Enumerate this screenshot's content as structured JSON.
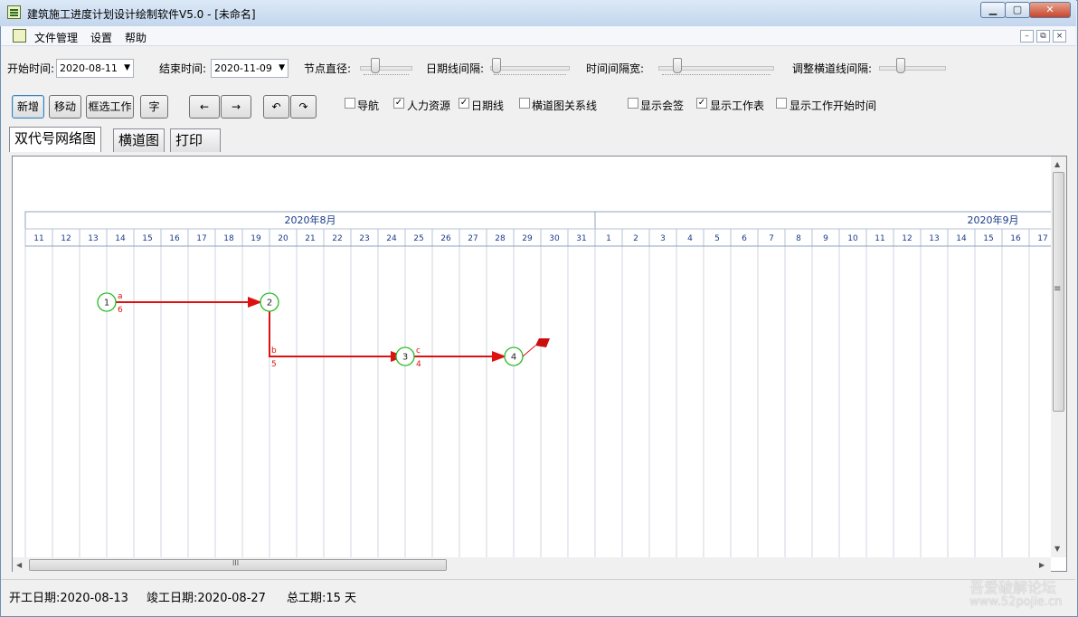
{
  "window": {
    "title": "建筑施工进度计划设计绘制软件V5.0 - [未命名]",
    "minimize_label": "▁",
    "maximize_label": "▢",
    "close_label": "✕"
  },
  "menu": {
    "items": [
      "文件管理",
      "设置",
      "帮助"
    ],
    "mdi_buttons": [
      "–",
      "⧉",
      "×"
    ]
  },
  "params": {
    "start_label": "开始时间:",
    "start_value": "2020-08-11",
    "end_label": "结束时间:",
    "end_value": "2020-11-09",
    "node_diameter_label": "节点直径:",
    "dateline_spacing_label": "日期线间隔:",
    "time_spacing_label": "时间间隔宽:",
    "lane_spacing_label": "调整横道线间隔:"
  },
  "toolbar": {
    "add": "新增",
    "move": "移动",
    "box_select": "框选工作",
    "text": "字",
    "left": "←",
    "right": "→",
    "undo": "↶",
    "redo": "↷"
  },
  "checkboxes": [
    {
      "label": "导航",
      "checked": false
    },
    {
      "label": "人力资源",
      "checked": true
    },
    {
      "label": "日期线",
      "checked": true
    },
    {
      "label": "横道图关系线",
      "checked": false
    },
    {
      "label": "显示会签",
      "checked": false
    },
    {
      "label": "显示工作表",
      "checked": true
    },
    {
      "label": "显示工作开始时间",
      "checked": false
    }
  ],
  "tabs": [
    "双代号网络图",
    "横道图",
    "打印"
  ],
  "chart_data": {
    "type": "network",
    "months": [
      {
        "label": "2020年8月",
        "days": [
          11,
          12,
          13,
          14,
          15,
          16,
          17,
          18,
          19,
          20,
          21,
          22,
          23,
          24,
          25,
          26,
          27,
          28,
          29,
          30,
          31
        ]
      },
      {
        "label": "2020年9月",
        "days": [
          1,
          2,
          3,
          4,
          5,
          6,
          7,
          8,
          9,
          10,
          11,
          12,
          13,
          14,
          15,
          16,
          17
        ]
      }
    ],
    "nodes": [
      {
        "id": "1",
        "day_index": 2,
        "row": 0
      },
      {
        "id": "2",
        "day_index": 8,
        "row": 0
      },
      {
        "id": "3",
        "day_index": 13,
        "row": 1
      },
      {
        "id": "4",
        "day_index": 17,
        "row": 1
      }
    ],
    "activities": [
      {
        "name": "a",
        "duration": "6",
        "from": "1",
        "to": "2"
      },
      {
        "name": "b",
        "duration": "5",
        "from": "2",
        "to": "3"
      },
      {
        "name": "c",
        "duration": "4",
        "from": "3",
        "to": "4"
      }
    ],
    "colors": {
      "arrow": "#dd1111",
      "node": "#22bb22",
      "header_text": "#1a3a8a"
    }
  },
  "status": {
    "start_date": "开工日期:2020-08-13",
    "end_date": "竣工日期:2020-08-27",
    "total": "总工期:15 天"
  },
  "watermark": {
    "line1": "吾爱破解论坛",
    "line2": "www.52pojie.cn"
  },
  "scrollbar": {
    "grip": "III",
    "grip_v": "≡"
  }
}
